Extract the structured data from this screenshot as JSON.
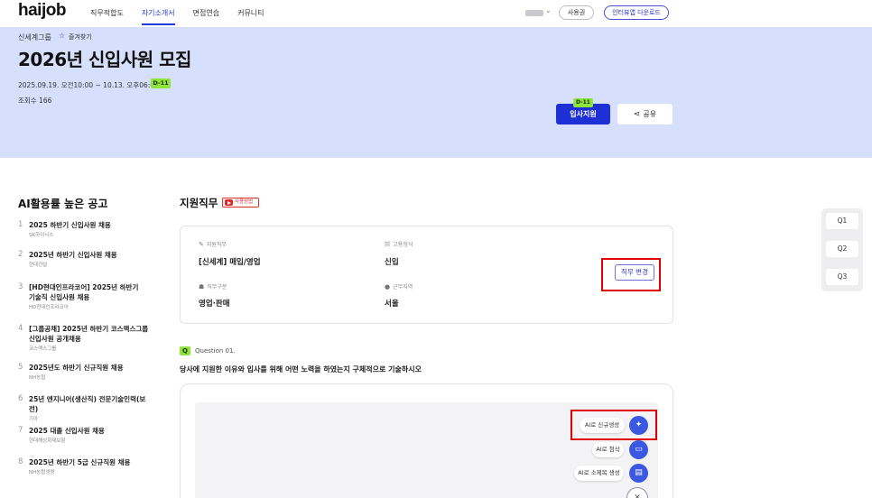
{
  "header": {
    "logo": "haijob",
    "nav": [
      "직무적합도",
      "자기소개서",
      "면접연습",
      "커뮤니티"
    ],
    "active_nav": "자기소개서",
    "ticket_label": "사용권",
    "download_label": "인터뷰앱 다운로드"
  },
  "hero": {
    "company": "신세계그룹",
    "favorite_label": "즐겨찾기",
    "title": "2026년 신입사원 모집",
    "period": "2025.09.19. 오전10:00 ~ 10.13. 오후06:00",
    "dday": "D-11",
    "views": "조회수 166",
    "apply_badge": "D-11",
    "apply_label": "입사지원",
    "share_label": "공유"
  },
  "left": {
    "title": "AI활용률 높은 공고",
    "jobs": [
      {
        "num": "1",
        "title": [
          "2025 하반기 신입사원 채용"
        ],
        "company": "SK하이닉스"
      },
      {
        "num": "2",
        "title": [
          "2025년 하반기 신입사원 채용"
        ],
        "company": "현대건설"
      },
      {
        "num": "3",
        "title": [
          "[HD현대인프라코어] 2025년 하반기",
          "기술직 신입사원 채용"
        ],
        "company": "HD현대인프라코어"
      },
      {
        "num": "4",
        "title": [
          "[그룹공채] 2025년 하반기 코스맥스그룹",
          "신입사원 공개채용"
        ],
        "company": "코스맥스그룹"
      },
      {
        "num": "5",
        "title": [
          "2025년도 하반기 신규직원 채용"
        ],
        "company": "NH농협"
      },
      {
        "num": "6",
        "title": [
          "25년 엔지니어(생산직) 전문기술인력(보전)"
        ],
        "company": "기아"
      },
      {
        "num": "7",
        "title": [
          "2025 대졸 신입사원 채용"
        ],
        "company": "현대해상화재보험"
      },
      {
        "num": "8",
        "title": [
          "2025년 하반기 5급 신규직원 채용"
        ],
        "company": "NH농협생명"
      }
    ]
  },
  "main": {
    "section_title": "지원직무",
    "video_label": "사용방법",
    "info": {
      "job_label": "지원직무",
      "job_value": "[신세계] 매입/영업",
      "employment_label": "고용형식",
      "employment_value": "신입",
      "category_label": "직무구분",
      "category_value": "영업·판매",
      "location_label": "근무지역",
      "location_value": "서울",
      "change_label": "직무 변경"
    },
    "question": {
      "tag": "Q",
      "number": "Question 01.",
      "text": "당사에 지원한 이유와 입사를 위해 어떤 노력을 하였는지 구체적으로 기술하시오"
    },
    "ai_tools": {
      "generate": "AI로 신규생성",
      "edit": "AI로 첨삭",
      "subtitle": "AI로 소제목 생성"
    }
  },
  "side_questions": [
    "Q1",
    "Q2",
    "Q3"
  ],
  "colors": {
    "brand": "#1e3ddb",
    "hero_bg": "#d6dffb",
    "badge_green": "#8fe33a",
    "highlight_red": "#e00000"
  }
}
